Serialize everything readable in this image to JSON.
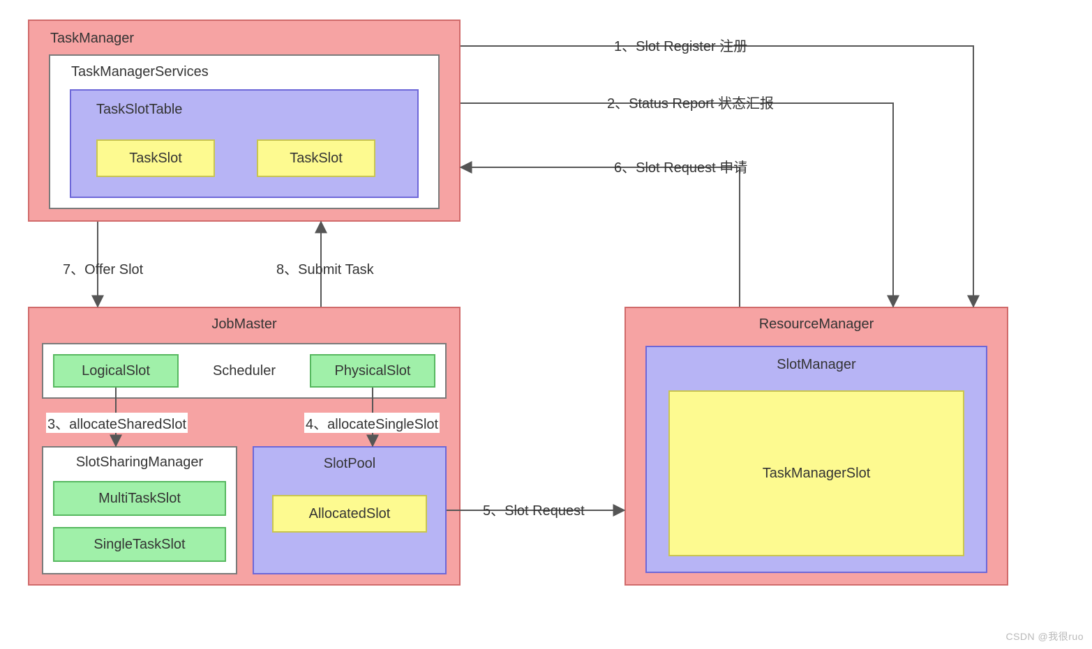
{
  "boxes": {
    "taskManager": "TaskManager",
    "taskManagerServices": "TaskManagerServices",
    "taskSlotTable": "TaskSlotTable",
    "taskSlot1": "TaskSlot",
    "taskSlot2": "TaskSlot",
    "jobMaster": "JobMaster",
    "scheduler": "Scheduler",
    "logicalSlot": "LogicalSlot",
    "physicalSlot": "PhysicalSlot",
    "slotSharingManager": "SlotSharingManager",
    "multiTaskSlot": "MultiTaskSlot",
    "singleTaskSlot": "SingleTaskSlot",
    "slotPool": "SlotPool",
    "allocatedSlot": "AllocatedSlot",
    "resourceManager": "ResourceManager",
    "slotManager": "SlotManager",
    "taskManagerSlot": "TaskManagerSlot"
  },
  "arrows": {
    "a1": "1、Slot Register 注册",
    "a2": "2、Status Report 状态汇报",
    "a3": "3、allocateSharedSlot",
    "a4": "4、allocateSingleSlot",
    "a5": "5、Slot Request",
    "a6": "6、Slot Request 申请",
    "a7": "7、Offer Slot",
    "a8": "8、Submit Task"
  },
  "watermark": "CSDN @我很ruo",
  "colors": {
    "pink": "#f6a3a3",
    "white": "#ffffff",
    "purple": "#b7b4f5",
    "yellow": "#fdfa90",
    "green": "#a0f0a9"
  }
}
